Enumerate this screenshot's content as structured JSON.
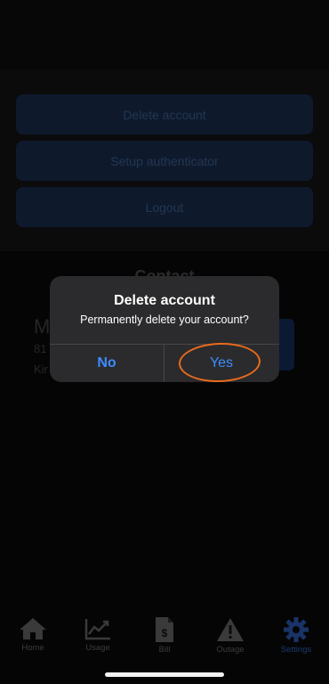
{
  "settings": {
    "buttons": [
      {
        "label": "Delete account"
      },
      {
        "label": "Setup authenticator"
      },
      {
        "label": "Logout"
      }
    ],
    "contact_heading": "Contact",
    "contact_card": {
      "initial": "M",
      "line1": "81",
      "line2": "Kir"
    }
  },
  "dialog": {
    "title": "Delete account",
    "message": "Permanently delete your account?",
    "no_label": "No",
    "yes_label": "Yes"
  },
  "tabbar": {
    "tabs": [
      {
        "label": "Home",
        "icon": "home-icon"
      },
      {
        "label": "Usage",
        "icon": "chart-icon"
      },
      {
        "label": "Bill",
        "icon": "bill-icon"
      },
      {
        "label": "Outage",
        "icon": "warning-icon"
      },
      {
        "label": "Settings",
        "icon": "gear-icon"
      }
    ],
    "active": "Settings"
  },
  "colors": {
    "accent": "#3d8cff",
    "highlight": "#e86a1c",
    "dialog_bg": "#2b2b2d"
  }
}
